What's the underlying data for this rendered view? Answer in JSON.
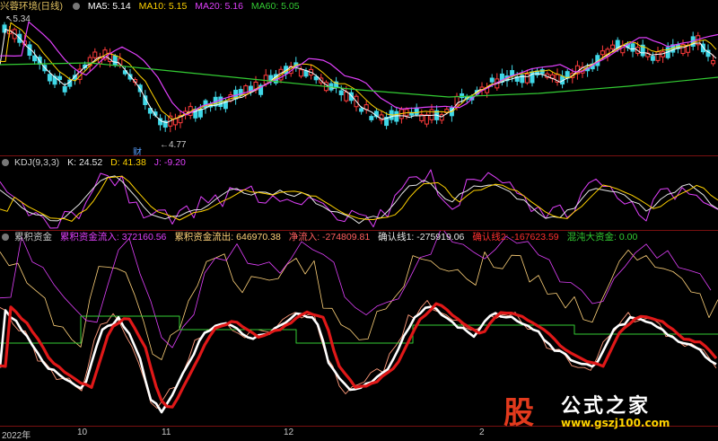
{
  "window": {
    "security_name": "兴蓉环境(日线)"
  },
  "main_panel": {
    "indicators": [
      {
        "label": "MA5: 5.14",
        "color": "#ffffff"
      },
      {
        "label": "MA10: 5.15",
        "color": "#ffd200"
      },
      {
        "label": "MA20: 5.16",
        "color": "#e040fb"
      },
      {
        "label": "MA60: 5.05",
        "color": "#33cc33"
      }
    ],
    "high_note": "5.34",
    "low_note": "4.77",
    "event_marker": "财"
  },
  "kdj_panel": {
    "name": "KDJ(9,3,3)",
    "values": [
      {
        "label": "K: 24.52",
        "color": "#e8e8e8"
      },
      {
        "label": "D: 41.38",
        "color": "#ffd200"
      },
      {
        "label": "J: -9.20",
        "color": "#e040fb"
      }
    ]
  },
  "fund_panel": {
    "name": "累积资金",
    "values": [
      {
        "label": "累积资金流入: 372160.56",
        "color": "#e040fb"
      },
      {
        "label": "累积资金流出: 646970.38",
        "color": "#ffd27a"
      },
      {
        "label": "净流入: -274809.81",
        "color": "#ff6060"
      },
      {
        "label": "确认线1: -275919.06",
        "color": "#e8e8e8"
      },
      {
        "label": "确认线2: -167623.59",
        "color": "#ff3030"
      },
      {
        "label": "混沌大资金: 0.00",
        "color": "#33cc33"
      }
    ]
  },
  "x_axis": {
    "labels": [
      "2022年",
      "10",
      "11",
      "12",
      "2"
    ]
  },
  "watermark": {
    "logo_char": "股",
    "site_title": "公式之家",
    "url": "www.gszj100.com"
  }
}
